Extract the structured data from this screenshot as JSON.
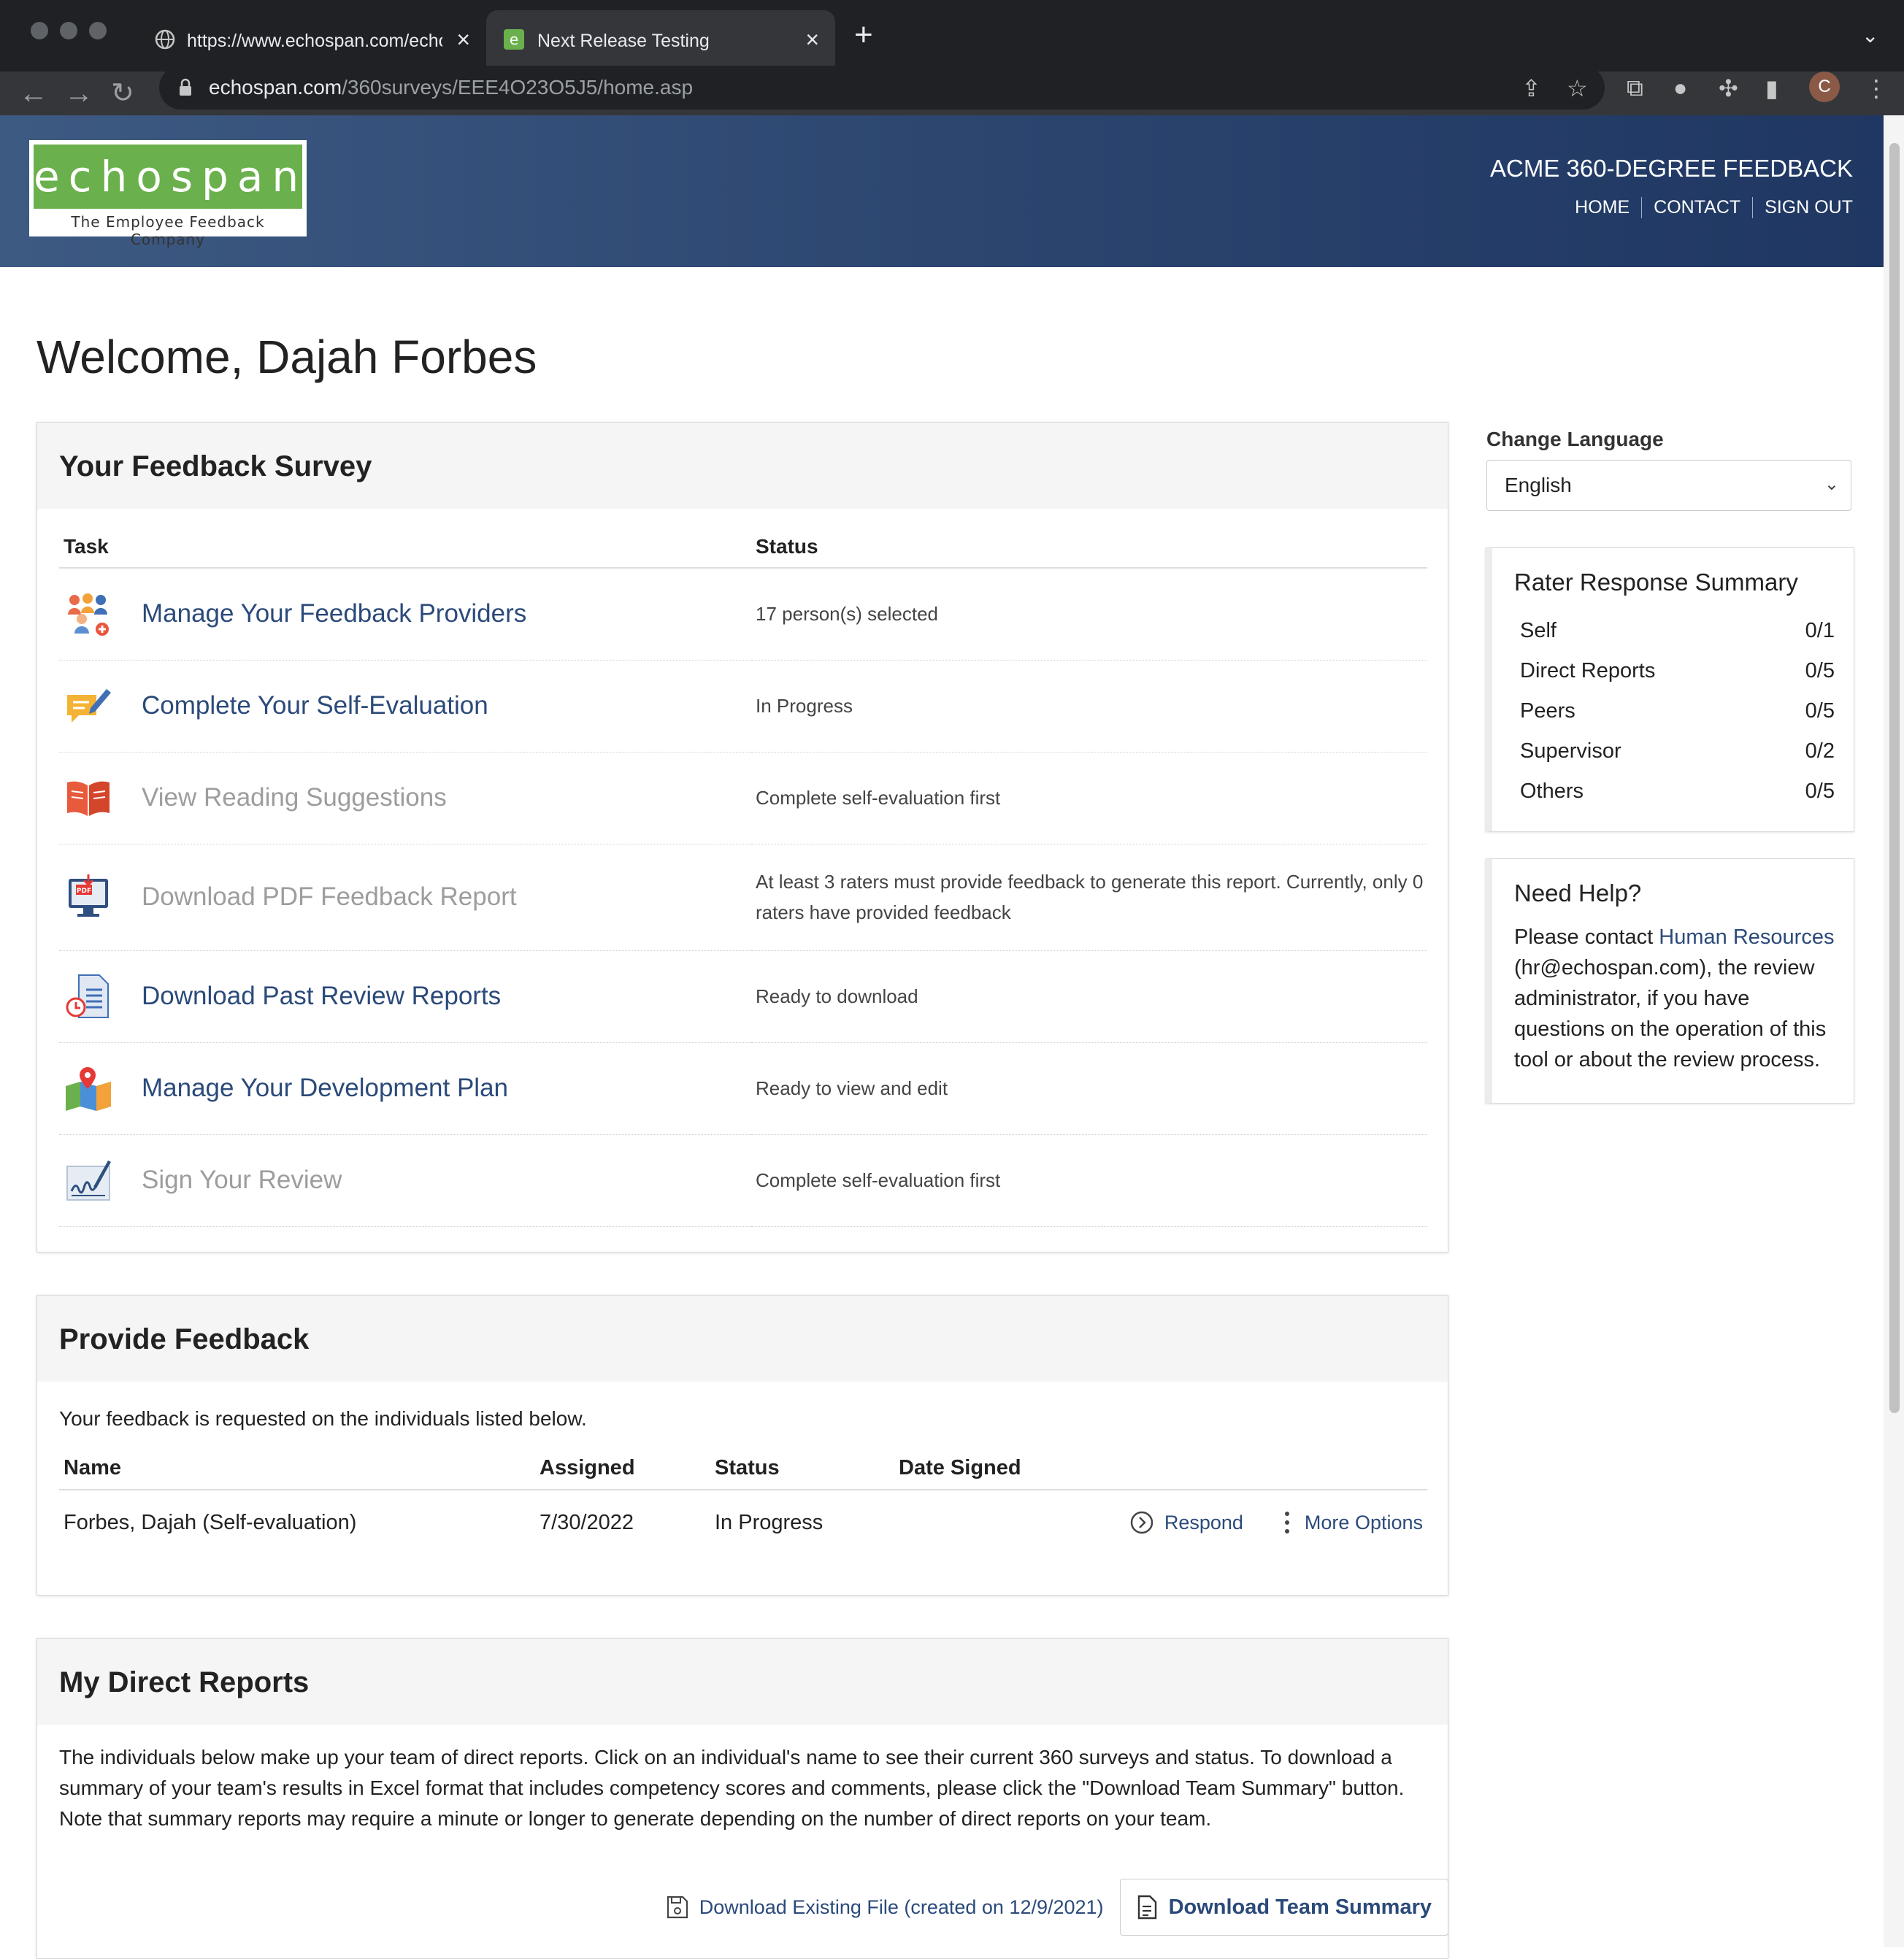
{
  "browser": {
    "tabs": [
      {
        "title": "https://www.echospan.com/echospan/...",
        "active": false
      },
      {
        "title": "Next Release Testing",
        "active": true
      }
    ],
    "url_domain": "echospan.com",
    "url_path": "/360surveys/EEE4O23O5J5/home.asp",
    "profile_initial": "C"
  },
  "header": {
    "logo_text": "echospan",
    "logo_tagline": "The Employee Feedback Company",
    "site_title": "ACME 360-DEGREE FEEDBACK",
    "nav": [
      "HOME",
      "CONTACT",
      "SIGN OUT"
    ]
  },
  "welcome": "Welcome, Dajah Forbes",
  "survey": {
    "title": "Your Feedback Survey",
    "columns": [
      "Task",
      "Status"
    ],
    "tasks": [
      {
        "label": "Manage Your Feedback Providers",
        "status": "17 person(s) selected",
        "enabled": true,
        "icon": "people-add-icon"
      },
      {
        "label": "Complete Your Self-Evaluation",
        "status": "In Progress",
        "enabled": true,
        "icon": "edit-comment-icon"
      },
      {
        "label": "View Reading Suggestions",
        "status": "Complete self-evaluation first",
        "enabled": false,
        "icon": "book-icon"
      },
      {
        "label": "Download PDF Feedback Report",
        "status": "At least 3 raters must provide feedback to generate this report. Currently, only 0 raters have provided feedback",
        "enabled": false,
        "icon": "pdf-download-icon"
      },
      {
        "label": "Download Past Review Reports",
        "status": "Ready to download",
        "enabled": true,
        "icon": "report-clock-icon"
      },
      {
        "label": "Manage Your Development Plan",
        "status": "Ready to view and edit",
        "enabled": true,
        "icon": "map-pin-icon"
      },
      {
        "label": "Sign Your Review",
        "status": "Complete self-evaluation first",
        "enabled": false,
        "icon": "signature-icon"
      }
    ]
  },
  "provide_feedback": {
    "title": "Provide Feedback",
    "intro": "Your feedback is requested on the individuals listed below.",
    "columns": [
      "Name",
      "Assigned",
      "Status",
      "Date Signed"
    ],
    "rows": [
      {
        "name": "Forbes, Dajah (Self-evaluation)",
        "assigned": "7/30/2022",
        "status": "In Progress",
        "date_signed": "",
        "respond_label": "Respond",
        "more_label": "More Options"
      }
    ]
  },
  "direct_reports": {
    "title": "My Direct Reports",
    "intro": "The individuals below make up your team of direct reports. Click on an individual's name to see their current 360 surveys and status. To download a summary of your team's results in Excel format that includes competency scores and comments, please click the \"Download Team Summary\" button. Note that summary reports may require a minute or longer to generate depending on the number of direct reports on your team.",
    "download_existing": "Download Existing File (created on 12/9/2021)",
    "download_team": "Download Team Summary"
  },
  "sidebar": {
    "language_label": "Change Language",
    "language_value": "English",
    "rater_title": "Rater Response Summary",
    "raters": [
      {
        "group": "Self",
        "count": "0/1"
      },
      {
        "group": "Direct Reports",
        "count": "0/5"
      },
      {
        "group": "Peers",
        "count": "0/5"
      },
      {
        "group": "Supervisor",
        "count": "0/2"
      },
      {
        "group": "Others",
        "count": "0/5"
      }
    ],
    "help_title": "Need Help?",
    "help_prefix": "Please contact ",
    "help_link": "Human Resources",
    "help_suffix": " (hr@echospan.com), the review administrator, if you have questions on the operation of this tool or about the review process."
  },
  "colors": {
    "link": "#2b4a7a",
    "header_start": "#3d5a83",
    "header_end": "#1f3762",
    "logo_green": "#6ab04c",
    "disabled": "#9d9d9d"
  }
}
